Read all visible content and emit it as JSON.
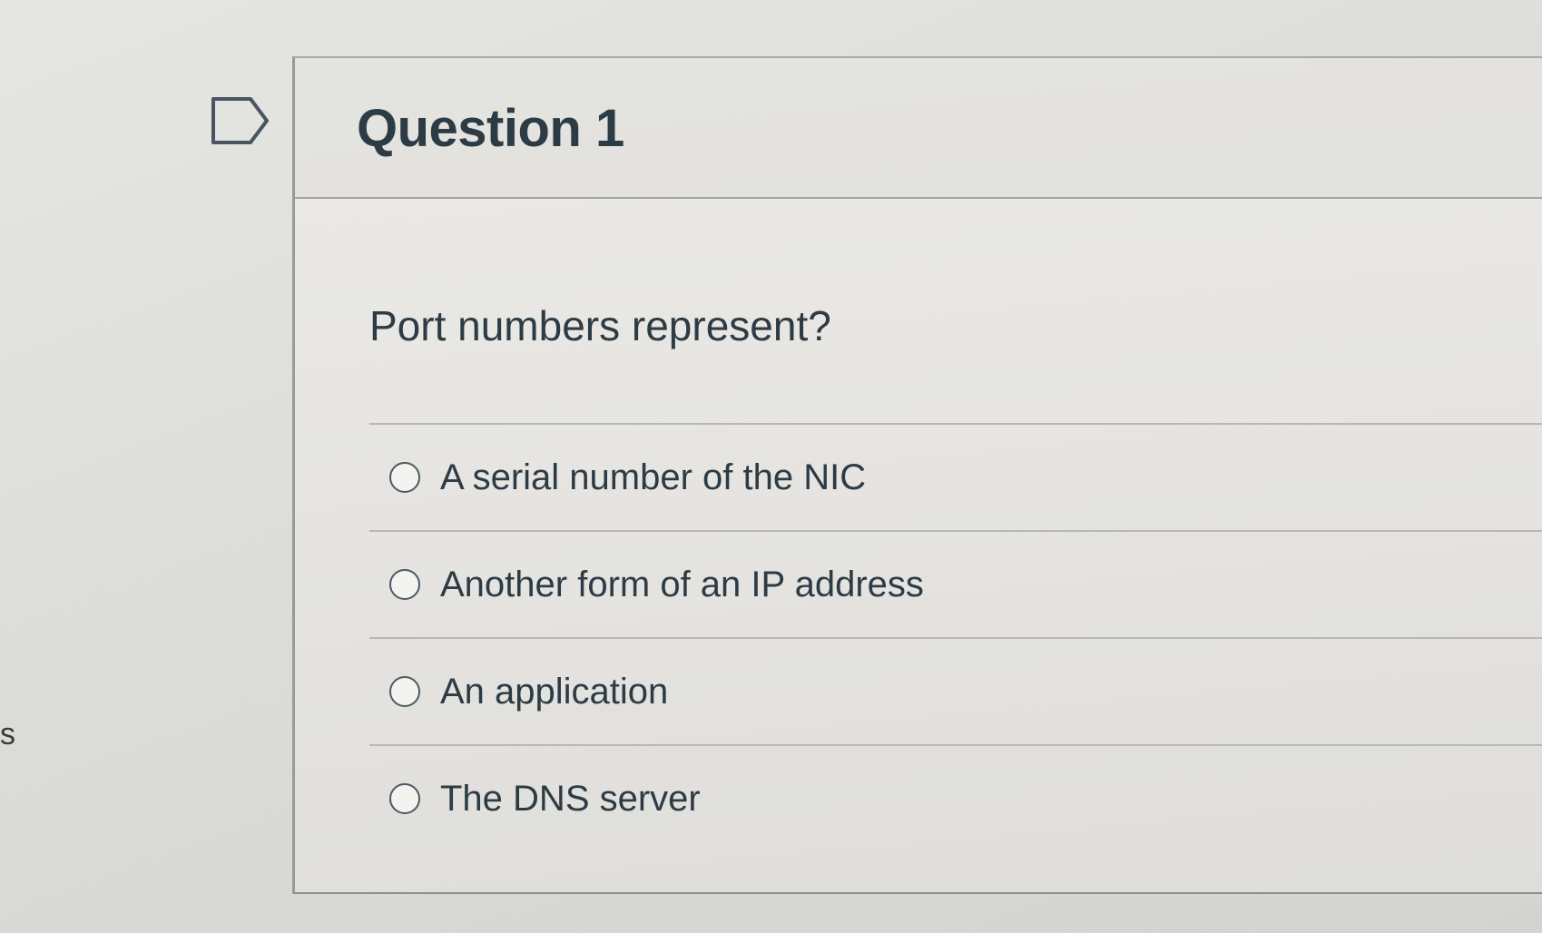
{
  "side_text": "s",
  "question": {
    "title": "Question 1",
    "text": "Port numbers represent?",
    "flag_icon": "flag-outline-icon",
    "answers": [
      {
        "label": "A serial number of the NIC",
        "selected": false
      },
      {
        "label": "Another form of an IP address",
        "selected": false
      },
      {
        "label": "An application",
        "selected": false
      },
      {
        "label": "The DNS server",
        "selected": false
      }
    ]
  },
  "colors": {
    "text": "#2d3b45",
    "border": "#a2a2a0",
    "background": "#e4e3df"
  }
}
